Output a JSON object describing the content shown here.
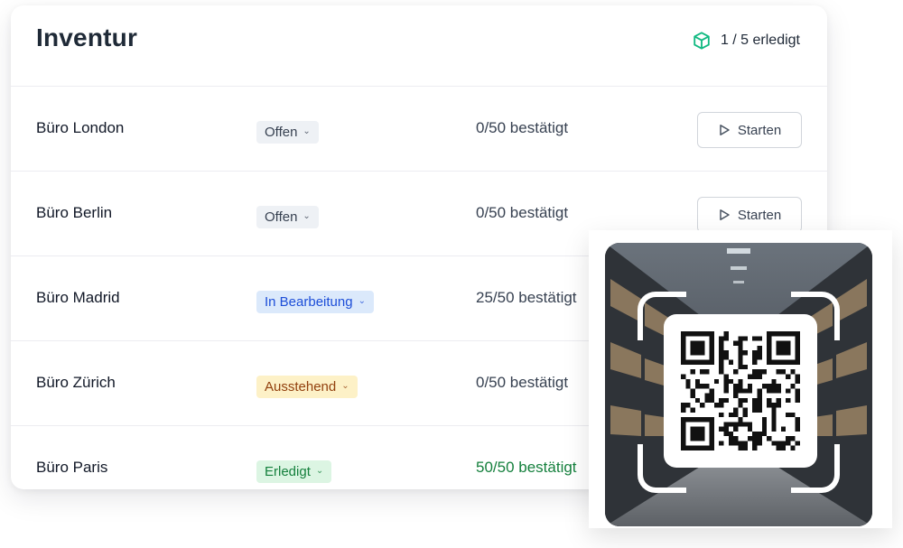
{
  "header": {
    "title": "Inventur",
    "progress_icon": "box-icon",
    "progress_text": "1 / 5 erledigt",
    "accent_color": "#10b981"
  },
  "locations": [
    {
      "name": "Büro London",
      "status": "Offen",
      "status_style": "open",
      "count": "0/50 bestätigt",
      "action": "Starten"
    },
    {
      "name": "Büro Berlin",
      "status": "Offen",
      "status_style": "open",
      "count": "0/50 bestätigt",
      "action": "Starten"
    },
    {
      "name": "Büro Madrid",
      "status": "In Bearbeitung",
      "status_style": "progress",
      "count": "25/50 bestätigt",
      "action": ""
    },
    {
      "name": "Büro Zürich",
      "status": "Ausstehend",
      "status_style": "pending",
      "count": "0/50 bestätigt",
      "action": ""
    },
    {
      "name": "Büro Paris",
      "status": "Erledigt",
      "status_style": "done",
      "count": "50/50 bestätigt",
      "action": ""
    }
  ],
  "status_colors": {
    "open": {
      "bg": "#eef1f5",
      "fg": "#374151"
    },
    "progress": {
      "bg": "#dbe9fb",
      "fg": "#1d4ed8"
    },
    "pending": {
      "bg": "#fdf1c7",
      "fg": "#92400e"
    },
    "done": {
      "bg": "#dcf5e3",
      "fg": "#15803d"
    }
  },
  "icons": {
    "status_chevron": "chevron-down-icon",
    "start": "play-icon",
    "scanner_code": "qr-code-icon"
  }
}
